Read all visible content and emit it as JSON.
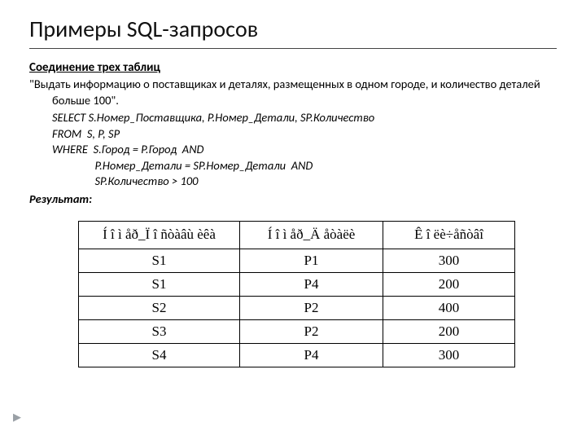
{
  "title": "Примеры SQL-запросов",
  "subtitle": "Соединение трех таблиц",
  "description": "\"Выдать информацию о поставщиках и деталях, размещенных в одном городе, и количество деталей больше 100\".",
  "sql": {
    "line1": "SELECT S.Номер_Поставщика, P.Номер_Детали, SP.Количество",
    "line2": "FROM  S, P, SP",
    "line3": "WHERE  S.Город = P.Город  AND",
    "line4": "                P.Номер_Детали = SP.Номер_Детали  AND",
    "line5": "                SP.Количество > 100"
  },
  "result_label": "Результат:",
  "table": {
    "headers": [
      "Í î ì åð_Ï î ñòàâù èêà",
      "Í î ì åð_Ä åòàëè",
      "Ê î ëè÷åñòâî"
    ],
    "rows": [
      [
        "S1",
        "P1",
        "300"
      ],
      [
        "S1",
        "P4",
        "200"
      ],
      [
        "S2",
        "P2",
        "400"
      ],
      [
        "S3",
        "P2",
        "200"
      ],
      [
        "S4",
        "P4",
        "300"
      ]
    ]
  },
  "marker": "▶"
}
